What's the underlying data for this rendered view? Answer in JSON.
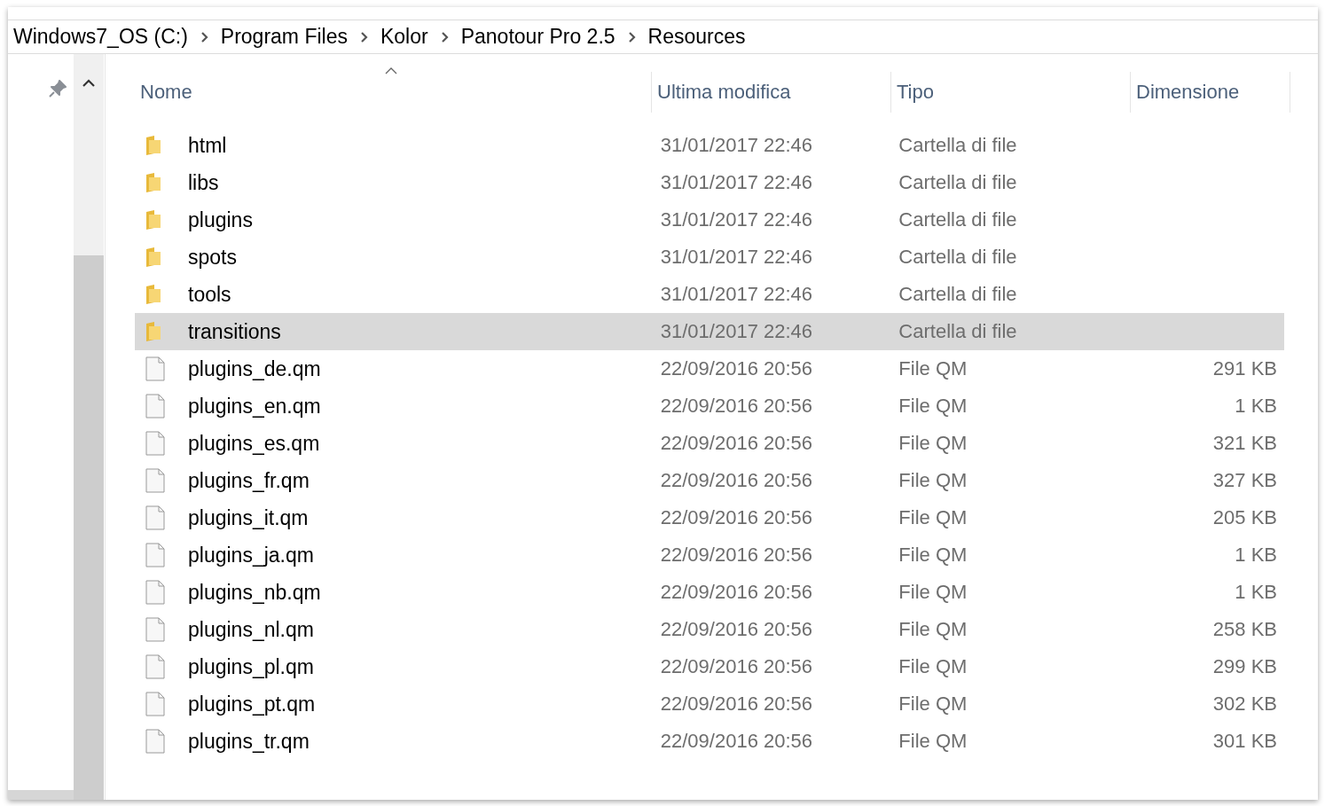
{
  "breadcrumb": [
    "Windows7_OS (C:)",
    "Program Files",
    "Kolor",
    "Panotour Pro 2.5",
    "Resources"
  ],
  "columns": [
    "Nome",
    "Ultima modifica",
    "Tipo",
    "Dimensione"
  ],
  "rows": [
    {
      "kind": "folder",
      "name": "html",
      "modified": "31/01/2017 22:46",
      "type": "Cartella di file",
      "selected": false
    },
    {
      "kind": "folder",
      "name": "libs",
      "modified": "31/01/2017 22:46",
      "type": "Cartella di file",
      "selected": false
    },
    {
      "kind": "folder",
      "name": "plugins",
      "modified": "31/01/2017 22:46",
      "type": "Cartella di file",
      "selected": false
    },
    {
      "kind": "folder",
      "name": "spots",
      "modified": "31/01/2017 22:46",
      "type": "Cartella di file",
      "selected": false
    },
    {
      "kind": "folder",
      "name": "tools",
      "modified": "31/01/2017 22:46",
      "type": "Cartella di file",
      "selected": false
    },
    {
      "kind": "folder",
      "name": "transitions",
      "modified": "31/01/2017 22:46",
      "type": "Cartella di file",
      "selected": true
    },
    {
      "kind": "file",
      "name": "plugins_de.qm",
      "modified": "22/09/2016 20:56",
      "type": "File QM",
      "size": "291 KB",
      "selected": false
    },
    {
      "kind": "file",
      "name": "plugins_en.qm",
      "modified": "22/09/2016 20:56",
      "type": "File QM",
      "size": "1 KB",
      "selected": false
    },
    {
      "kind": "file",
      "name": "plugins_es.qm",
      "modified": "22/09/2016 20:56",
      "type": "File QM",
      "size": "321 KB",
      "selected": false
    },
    {
      "kind": "file",
      "name": "plugins_fr.qm",
      "modified": "22/09/2016 20:56",
      "type": "File QM",
      "size": "327 KB",
      "selected": false
    },
    {
      "kind": "file",
      "name": "plugins_it.qm",
      "modified": "22/09/2016 20:56",
      "type": "File QM",
      "size": "205 KB",
      "selected": false
    },
    {
      "kind": "file",
      "name": "plugins_ja.qm",
      "modified": "22/09/2016 20:56",
      "type": "File QM",
      "size": "1 KB",
      "selected": false
    },
    {
      "kind": "file",
      "name": "plugins_nb.qm",
      "modified": "22/09/2016 20:56",
      "type": "File QM",
      "size": "1 KB",
      "selected": false
    },
    {
      "kind": "file",
      "name": "plugins_nl.qm",
      "modified": "22/09/2016 20:56",
      "type": "File QM",
      "size": "258 KB",
      "selected": false
    },
    {
      "kind": "file",
      "name": "plugins_pl.qm",
      "modified": "22/09/2016 20:56",
      "type": "File QM",
      "size": "299 KB",
      "selected": false
    },
    {
      "kind": "file",
      "name": "plugins_pt.qm",
      "modified": "22/09/2016 20:56",
      "type": "File QM",
      "size": "302 KB",
      "selected": false
    },
    {
      "kind": "file",
      "name": "plugins_tr.qm",
      "modified": "22/09/2016 20:56",
      "type": "File QM",
      "size": "301 KB",
      "selected": false
    }
  ]
}
